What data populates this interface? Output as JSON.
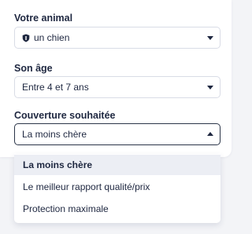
{
  "form": {
    "animal": {
      "label": "Votre animal",
      "value": "un chien",
      "icon": "shield-icon"
    },
    "age": {
      "label": "Son âge",
      "value": "Entre 4 et 7 ans"
    },
    "coverage": {
      "label": "Couverture souhaitée",
      "value": "La moins chère",
      "options": [
        "La moins chère",
        "Le meilleur rapport qualité/prix",
        "Protection maximale"
      ]
    }
  },
  "colors": {
    "text": "#1e2740",
    "border": "#d9dce6",
    "selected_bg": "#eceef4",
    "page_bg": "#f3f4f7"
  }
}
